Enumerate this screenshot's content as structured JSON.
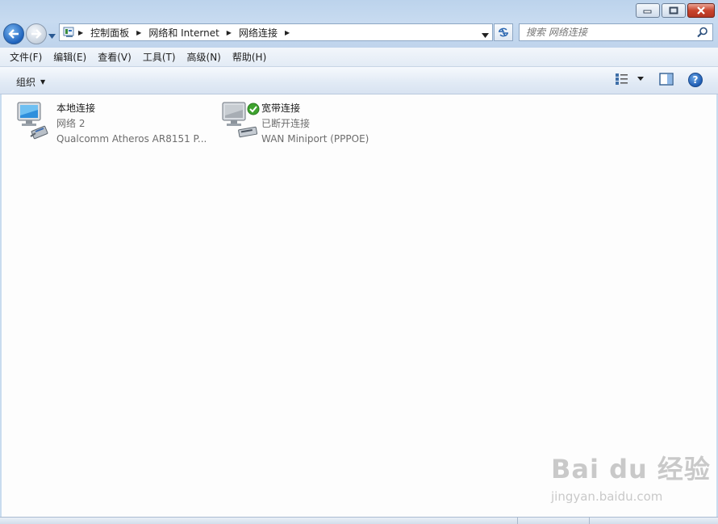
{
  "window": {
    "minimize_glyph": "▁",
    "maximize_glyph": "▢",
    "close_glyph": "✕"
  },
  "address": {
    "crumbs": [
      "控制面板",
      "网络和 Internet",
      "网络连接"
    ]
  },
  "search": {
    "placeholder": "搜索 网络连接"
  },
  "menu": {
    "items": [
      "文件(F)",
      "编辑(E)",
      "查看(V)",
      "工具(T)",
      "高级(N)",
      "帮助(H)"
    ]
  },
  "command_bar": {
    "organize_label": "组织",
    "help_label": "?"
  },
  "connections": [
    {
      "name": "本地连接",
      "status": "网络  2",
      "device": "Qualcomm Atheros AR8151 P..."
    },
    {
      "name": "宽带连接",
      "status": "已断开连接",
      "device": "WAN Miniport (PPPOE)"
    }
  ],
  "watermark": {
    "brand": "Bai  du 经验",
    "url": "jingyan.baidu.com"
  },
  "colors": {
    "accent": "#1f63bd",
    "close_button": "#c8442c",
    "secondary_text": "#6d6d6d"
  }
}
